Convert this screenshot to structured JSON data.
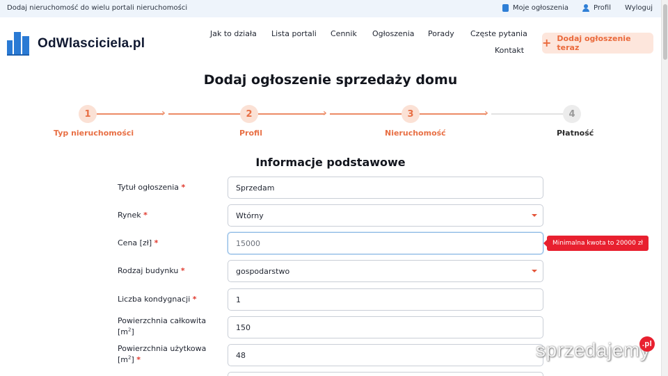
{
  "topbar": {
    "tagline": "Dodaj nieruchomość do wielu portali nieruchomości",
    "links": [
      {
        "label": "Moje ogłoszenia",
        "icon": "box-icon"
      },
      {
        "label": "Profil",
        "icon": "user-icon"
      },
      {
        "label": "Wyloguj",
        "icon": ""
      }
    ]
  },
  "brand": {
    "name": "OdWlasciciela.pl",
    "color": "#2a7ad4"
  },
  "nav": {
    "items": [
      "Jak to działa",
      "Lista portali",
      "Cennik",
      "Ogłoszenia",
      "Porady",
      "Częste pytania",
      "Kontakt"
    ]
  },
  "cta": {
    "label": "Dodaj ogłoszenie teraz",
    "color": "#ea6a3c"
  },
  "page": {
    "title": "Dodaj ogłoszenie sprzedaży domu",
    "section_title": "Informacje podstawowe"
  },
  "steps": [
    {
      "number": "1",
      "label": "Typ nieruchomości",
      "state": "done"
    },
    {
      "number": "2",
      "label": "Profil",
      "state": "done"
    },
    {
      "number": "3",
      "label": "Nieruchomość",
      "state": "current"
    },
    {
      "number": "4",
      "label": "Płatność",
      "state": "pending"
    }
  ],
  "form": {
    "title": {
      "label": "Tytuł ogłoszenia",
      "required": "*",
      "value": "Sprzedam"
    },
    "market": {
      "label": "Rynek",
      "required": "*",
      "value": "Wtórny"
    },
    "price": {
      "label": "Cena [zł]",
      "required": "*",
      "value": "15000"
    },
    "building_type": {
      "label": "Rodzaj budynku",
      "required": "*",
      "value": "gospodarstwo"
    },
    "floors": {
      "label": "Liczba kondygnacji",
      "required": "*",
      "value": "1"
    },
    "total_area": {
      "label": "Powierzchnia całkowita",
      "unit_prefix": "[m",
      "unit_sup": "2",
      "unit_suffix": "]",
      "required": "",
      "value": "150"
    },
    "usable_area": {
      "label": "Powierzchnia użytkowa",
      "unit_prefix": "[m",
      "unit_sup": "2",
      "unit_suffix": "]",
      "required": "*",
      "value": "48"
    }
  },
  "validation": {
    "price_error": "Minimalna kwota to 20000 zł"
  },
  "watermark": {
    "text": "sprzedajemy",
    "badge": ".pl"
  }
}
